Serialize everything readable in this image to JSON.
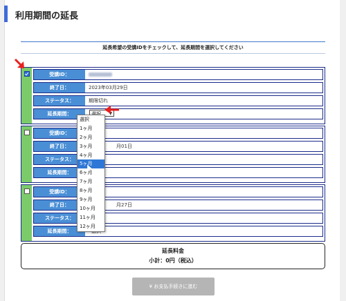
{
  "page": {
    "title": "利用期間の延長",
    "instruction": "延長希望の受講IDをチェックして、延長期間を選択してください"
  },
  "labels": {
    "id": "受講ID：",
    "end": "終了日：",
    "status": "ステータス：",
    "period": "延長期間："
  },
  "courses": [
    {
      "checked": true,
      "end_date": "2023年03月29日",
      "status": "期限切れ",
      "selected": "選択"
    },
    {
      "checked": false,
      "end_date": "月01日",
      "status": "",
      "selected": ""
    },
    {
      "checked": false,
      "end_date": "月27日",
      "status": "",
      "selected": "選択"
    }
  ],
  "dropdown": {
    "options": [
      "選択",
      "1ヶ月",
      "2ヶ月",
      "3ヶ月",
      "4ヶ月",
      "5ヶ月",
      "6ヶ月",
      "7ヶ月",
      "8ヶ月",
      "9ヶ月",
      "10ヶ月",
      "11ヶ月",
      "12ヶ月"
    ],
    "highlighted_index": 5
  },
  "fee": {
    "title": "延長料金",
    "subtotal": "小計：0円（税込）"
  },
  "pay_button": "¥ お支払手続きに進む",
  "colors": {
    "accent": "#3f6ad8",
    "label_blue": "#4a8fd6",
    "check_green": "#7ccb6b",
    "annotation_red": "#e8201e"
  }
}
